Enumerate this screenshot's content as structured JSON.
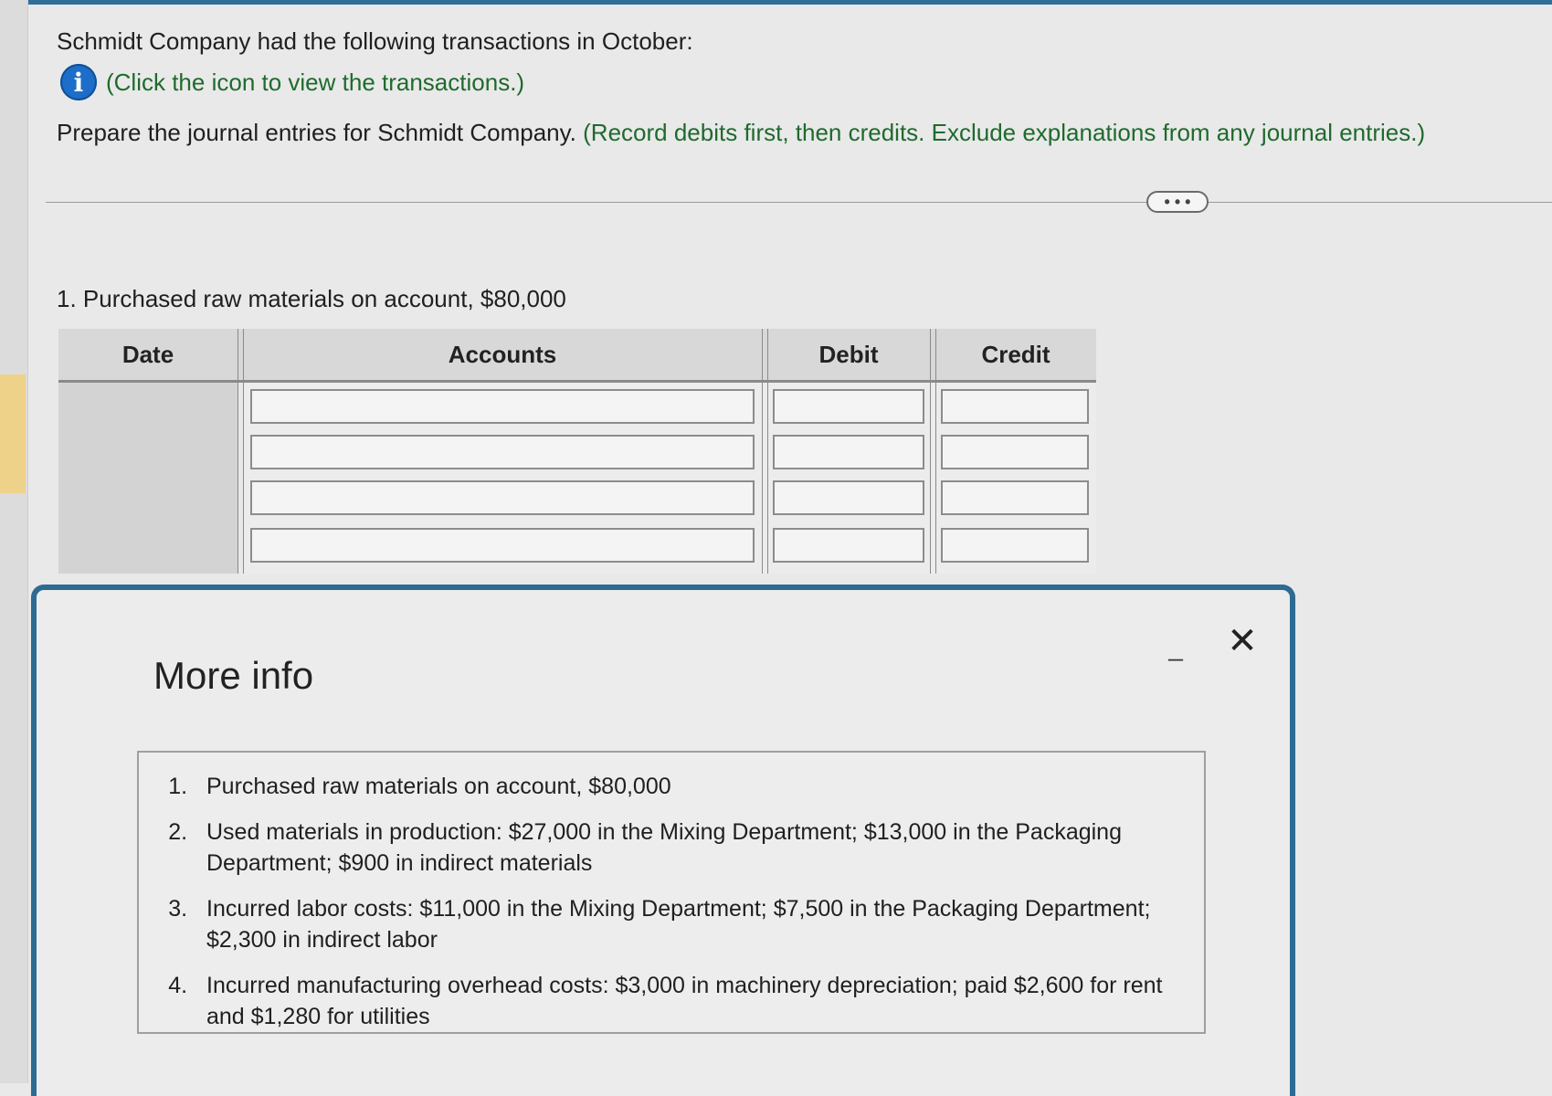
{
  "problem": {
    "intro": "Schmidt Company had the following transactions in October:",
    "info_link": "(Click the icon to view the transactions.)",
    "instruction_main": "Prepare the journal entries for Schmidt Company.",
    "instruction_green": "(Record debits first, then credits. Exclude explanations from any journal entries.)",
    "more_label": "• • •"
  },
  "question": {
    "label": "1. Purchased raw materials on account, $80,000"
  },
  "journal": {
    "headers": {
      "date": "Date",
      "accounts": "Accounts",
      "debit": "Debit",
      "credit": "Credit"
    },
    "rows": [
      {
        "account": "",
        "debit": "",
        "credit": ""
      },
      {
        "account": "",
        "debit": "",
        "credit": ""
      },
      {
        "account": "",
        "debit": "",
        "credit": ""
      },
      {
        "account": "",
        "debit": "",
        "credit": ""
      }
    ]
  },
  "modal": {
    "title": "More info",
    "minimize": "_",
    "close": "✕",
    "transactions": [
      "Purchased raw materials on account, $80,000",
      "Used materials in production: $27,000 in the Mixing Department; $13,000 in the Packaging Department; $900 in indirect materials",
      "Incurred labor costs: $11,000 in the Mixing Department; $7,500 in the Packaging Department; $2,300 in indirect labor",
      "Incurred manufacturing overhead costs: $3,000 in machinery depreciation; paid $2,600 for rent and $1,280 for utilities"
    ]
  },
  "colors": {
    "accent_blue": "#2d6b92",
    "info_icon": "#1c6ec8",
    "instruction_green": "#1f6a2d"
  }
}
